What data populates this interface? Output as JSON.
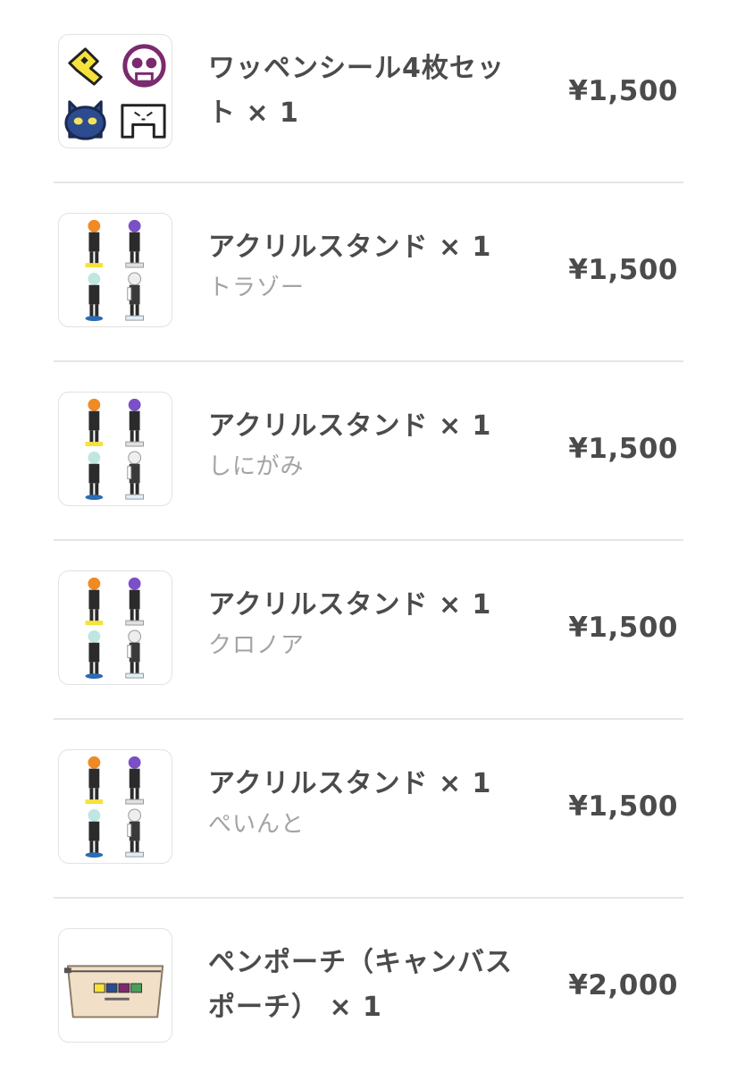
{
  "items": [
    {
      "title_line1": "ワッペンシール4枚セッ",
      "title_line2": "ト × 1",
      "variant": "",
      "price": "¥1,500",
      "thumb_icon": "patch-sticker-set-icon"
    },
    {
      "title_line1": "アクリルスタンド × 1",
      "title_line2": "",
      "variant": "トラゾー",
      "price": "¥1,500",
      "thumb_icon": "acrylic-stand-icon"
    },
    {
      "title_line1": "アクリルスタンド × 1",
      "title_line2": "",
      "variant": "しにがみ",
      "price": "¥1,500",
      "thumb_icon": "acrylic-stand-icon"
    },
    {
      "title_line1": "アクリルスタンド × 1",
      "title_line2": "",
      "variant": "クロノア",
      "price": "¥1,500",
      "thumb_icon": "acrylic-stand-icon"
    },
    {
      "title_line1": "アクリルスタンド × 1",
      "title_line2": "",
      "variant": "ぺいんと",
      "price": "¥1,500",
      "thumb_icon": "acrylic-stand-icon"
    },
    {
      "title_line1": "ペンポーチ（キャンバス",
      "title_line2": "ポーチ） × 1",
      "variant": "",
      "price": "¥2,000",
      "thumb_icon": "pen-pouch-icon"
    }
  ],
  "colors": {
    "text": "#4b4b4b",
    "variant_text": "#a3a3a3",
    "separator": "#e6e6e6",
    "thumb_border": "#e2e2e2"
  }
}
